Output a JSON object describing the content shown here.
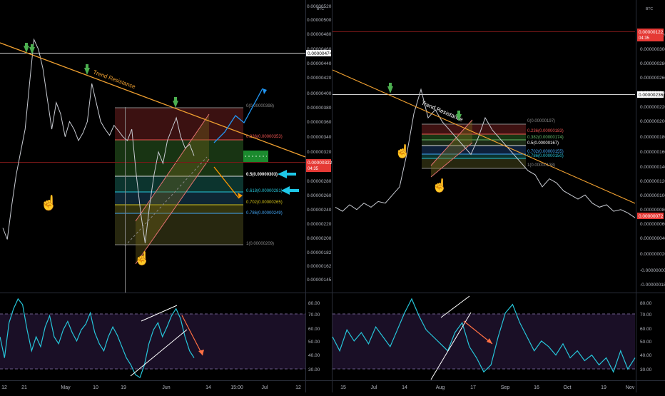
{
  "chart_data": [
    {
      "type": "line",
      "panel": "left-price",
      "y_axis_labels": [
        "0.00000520",
        "0.00000500",
        "0.00000480",
        "0.00000460",
        "0.00000440",
        "0.00000420",
        "0.00000400",
        "0.00000380",
        "0.00000360",
        "0.00000340",
        "0.00000320",
        "0.00000300",
        "0.00000280",
        "0.00000260",
        "0.00000240",
        "0.00000220",
        "0.00000200",
        "0.00000182",
        "0.00000162",
        "0.00000145"
      ],
      "axis_currency": "BTC",
      "x_axis_labels": [
        "12",
        "21",
        "May",
        "10",
        "19",
        "Jun",
        "14",
        "15:00",
        "Jul",
        "12"
      ],
      "ylim": [
        1.45e-06,
        5.3e-06
      ],
      "series": [
        {
          "values": [
            2.3e-06,
            2.15e-06,
            2.6e-06,
            3e-06,
            3.3e-06,
            3.6e-06,
            4.2e-06,
            4.78e-06,
            4.65e-06,
            4.4e-06,
            4e-06,
            3.6e-06,
            3.95e-06,
            3.8e-06,
            3.5e-06,
            3.7e-06,
            3.6e-06,
            3.45e-06,
            3.55e-06,
            3.7e-06,
            4.2e-06,
            3.95e-06,
            3.7e-06,
            3.6e-06,
            3.52e-06,
            3.65e-06,
            3.58e-06,
            3.5e-06,
            3.45e-06,
            3.6e-06,
            3e-06,
            2.5e-06,
            2.1e-06,
            2.6e-06,
            3e-06,
            3.3e-06,
            3.15e-06,
            3.45e-06,
            3.6e-06,
            3.75e-06,
            3.5e-06,
            3.35e-06,
            3.4e-06,
            3.25e-06
          ]
        }
      ],
      "price_tags": [
        "0.00000474",
        "0.00000322"
      ],
      "countdown": "04:35",
      "trend_label": "Trend Resistance",
      "fib_levels": [
        {
          "label": "0(0.00000398)",
          "value": 3.98e-06
        },
        {
          "label": "0.236(0.00000353)",
          "value": 3.53e-06
        },
        {
          "label": "0.5(0.00000303)",
          "value": 3.03e-06
        },
        {
          "label": "0.618(0.00000281)",
          "value": 2.81e-06
        },
        {
          "label": "0.702(0.00000265)",
          "value": 2.65e-06
        },
        {
          "label": "0.786(0.00000249)",
          "value": 2.49e-06
        },
        {
          "label": "1(0.00000209)",
          "value": 2.09e-06
        }
      ]
    },
    {
      "type": "line",
      "panel": "right-price",
      "y_axis_labels": [
        "0.000000320",
        "0.000000300",
        "0.000000280",
        "0.000000260",
        "0.000000240",
        "0.000000220",
        "0.000000200",
        "0.000000180",
        "0.000000160",
        "0.000000140",
        "0.000000120",
        "0.000000100",
        "0.000000080",
        "0.000000060",
        "0.000000040",
        "0.000000020",
        "-0.00000000",
        "-0.00000018"
      ],
      "axis_currency": "BTC",
      "x_axis_labels": [
        "15",
        "Jul",
        "14",
        "Aug",
        "17",
        "Sep",
        "16",
        "Oct",
        "19",
        "Nov"
      ],
      "ylim": [
        -2e-08,
        3.4e-07
      ],
      "series": [
        {
          "values": [
            8.5e-08,
            8e-08,
            8.8e-08,
            8.2e-08,
            9e-08,
            8.5e-08,
            9.2e-08,
            9e-08,
            1e-07,
            1.1e-07,
            1.5e-07,
            2e-07,
            2.3e-07,
            1.95e-07,
            2.05e-07,
            1.9e-07,
            1.8e-07,
            1.7e-07,
            1.6e-07,
            1.5e-07,
            1.7e-07,
            1.95e-07,
            1.8e-07,
            1.7e-07,
            1.6e-07,
            1.5e-07,
            1.4e-07,
            1.3e-07,
            1.25e-07,
            1.1e-07,
            1.2e-07,
            1.15e-07,
            1.05e-07,
            1e-07,
            9.5e-08,
            1e-07,
            9e-08,
            8.5e-08,
            8.8e-08,
            8e-08,
            8.2e-08,
            7.8e-08,
            7.2e-08
          ]
        }
      ],
      "price_tags": [
        "0.00000122",
        "0.00000236",
        "0.00000072"
      ],
      "countdown": "04:35",
      "trend_label": "Trend Resistance",
      "fib_levels": [
        {
          "label": "0(0.00000197)",
          "value": 1.97e-07
        },
        {
          "label": "0.236(0.00000183)",
          "value": 1.83e-07
        },
        {
          "label": "0.382(0.00000174)",
          "value": 1.74e-07
        },
        {
          "label": "0.5(0.00000167)",
          "value": 1.67e-07
        },
        {
          "label": "0.702(0.00000155)",
          "value": 1.55e-07
        },
        {
          "label": "0.786(0.00000150)",
          "value": 1.5e-07
        },
        {
          "label": "1(0.00000138)",
          "value": 1.38e-07
        }
      ]
    },
    {
      "type": "line",
      "panel": "left-rsi",
      "y_axis_labels": [
        "80.00",
        "70.00",
        "60.00",
        "50.00",
        "40.00",
        "30.00"
      ],
      "ylim": [
        24,
        86
      ],
      "series": [
        {
          "values": [
            55,
            40,
            65,
            75,
            82,
            78,
            60,
            45,
            55,
            48,
            62,
            70,
            55,
            50,
            60,
            66,
            58,
            52,
            60,
            64,
            72,
            58,
            50,
            45,
            55,
            62,
            56,
            48,
            40,
            35,
            28,
            26,
            35,
            50,
            60,
            65,
            55,
            62,
            70,
            75,
            68,
            55,
            45,
            40
          ]
        }
      ]
    },
    {
      "type": "line",
      "panel": "right-rsi",
      "y_axis_labels": [
        "80.00",
        "70.00",
        "60.00",
        "50.00",
        "40.00",
        "30.00"
      ],
      "ylim": [
        24,
        86
      ],
      "series": [
        {
          "values": [
            55,
            45,
            60,
            52,
            58,
            50,
            62,
            55,
            48,
            60,
            72,
            82,
            70,
            60,
            55,
            50,
            45,
            58,
            65,
            48,
            40,
            30,
            35,
            55,
            72,
            78,
            65,
            55,
            45,
            52,
            48,
            42,
            50,
            40,
            45,
            38,
            42,
            35,
            40,
            30,
            45,
            32,
            40
          ]
        }
      ]
    }
  ]
}
